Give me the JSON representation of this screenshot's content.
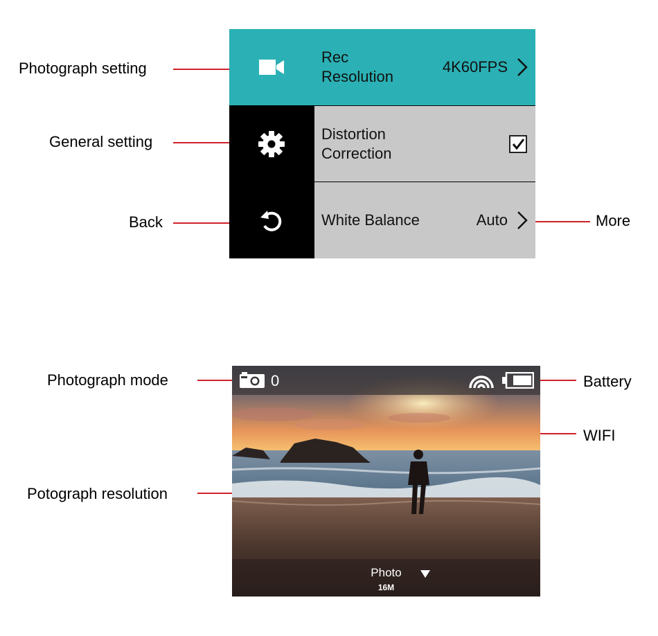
{
  "settings_panel": {
    "rows": [
      {
        "icon": "video-camera-icon",
        "label_line1": "Rec",
        "label_line2": "Resolution",
        "value": "4K60FPS"
      },
      {
        "icon": "gear-icon",
        "label_line1": "Distortion",
        "label_line2": "Correction",
        "checked": true
      },
      {
        "icon": "undo-icon",
        "label": "White Balance",
        "value": "Auto"
      }
    ]
  },
  "preview": {
    "mode_icon": "photo-mode-icon",
    "shot_count": "0",
    "wifi_icon": "wifi-icon",
    "battery_icon": "battery-icon",
    "resolution_mode": "Photo",
    "resolution_size": "16M"
  },
  "callouts": {
    "photograph_setting": "Photograph setting",
    "general_setting": "General setting",
    "back": "Back",
    "more": "More",
    "photograph_mode": "Photograph mode",
    "battery": "Battery",
    "wifi": "WIFI",
    "photograph_resolution": "Potograph resolution"
  },
  "colors": {
    "accent": "#2bb1b5",
    "leader_line": "#d0202a",
    "row_bg": "#c8c8c8",
    "sidebar_bg": "#000000"
  }
}
